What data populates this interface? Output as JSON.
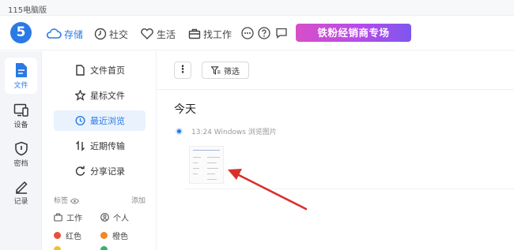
{
  "window": {
    "title": "115电脑版"
  },
  "topnav": {
    "logo": "5",
    "items": [
      {
        "label": "存储",
        "icon": "cloud-icon",
        "active": true
      },
      {
        "label": "社交",
        "icon": "clock-icon"
      },
      {
        "label": "生活",
        "icon": "heart-icon"
      },
      {
        "label": "找工作",
        "icon": "briefcase-icon"
      }
    ],
    "promo": "铁粉经销商专场"
  },
  "rail": {
    "items": [
      {
        "label": "文件",
        "icon": "file-icon",
        "active": true
      },
      {
        "label": "设备",
        "icon": "device-icon"
      },
      {
        "label": "密档",
        "icon": "shield-icon"
      },
      {
        "label": "记录",
        "icon": "pen-icon"
      }
    ]
  },
  "sidemenu": {
    "items": [
      {
        "label": "文件首页",
        "icon": "document-icon"
      },
      {
        "label": "星标文件",
        "icon": "star-icon"
      },
      {
        "label": "最近浏览",
        "icon": "history-icon",
        "active": true
      },
      {
        "label": "近期传输",
        "icon": "transfer-icon"
      },
      {
        "label": "分享记录",
        "icon": "share-icon"
      }
    ],
    "tags_label": "标签",
    "tags_add": "添加",
    "tags": [
      {
        "label": "工作",
        "icon": "briefcase-icon"
      },
      {
        "label": "个人",
        "icon": "person-icon"
      },
      {
        "label": "红色",
        "color": "#e8503a"
      },
      {
        "label": "橙色",
        "color": "#f08a24"
      },
      {
        "color": "#f2c12e"
      },
      {
        "color": "#36b36a"
      }
    ]
  },
  "main": {
    "more_label": "⋮",
    "filter_label": "筛选",
    "section_title": "今天",
    "entry_meta": "13:24 Windows 浏览图片"
  },
  "colors": {
    "accent": "#2a79e4",
    "arrow": "#d9302c"
  }
}
